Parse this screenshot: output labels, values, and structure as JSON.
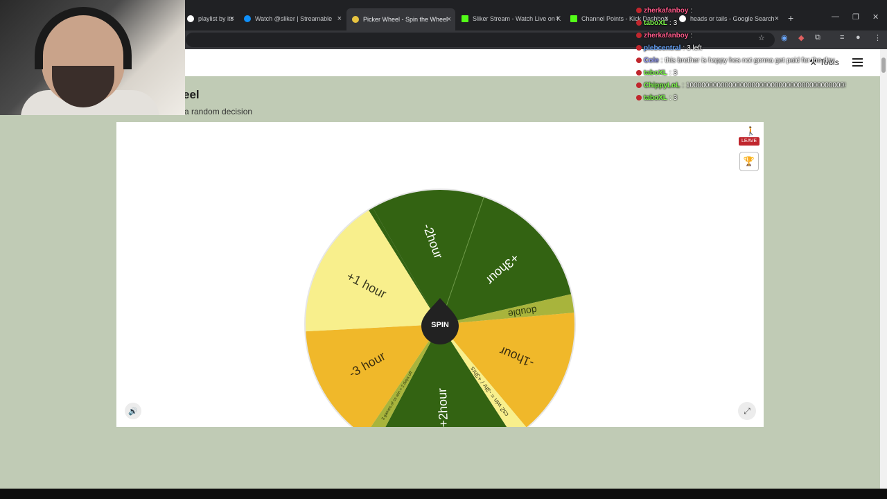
{
  "browser": {
    "tabs": [
      {
        "label": "playlist by its",
        "favicon_color": "#ffffff",
        "active": false
      },
      {
        "label": "Watch @sliker | Streamable",
        "favicon_color": "#0f90fa",
        "active": false
      },
      {
        "label": "Picker Wheel - Spin the Wheel",
        "favicon_color": "#e8c440",
        "active": true
      },
      {
        "label": "Sliker Stream - Watch Live on K",
        "favicon_color": "#53fc18",
        "active": false
      },
      {
        "label": "Channel Points - Kick Dashboa",
        "favicon_color": "#53fc18",
        "active": false
      },
      {
        "label": "heads or tails - Google Search",
        "favicon_color": "#ffffff",
        "active": false
      }
    ],
    "new_tab_label": "+",
    "tab_close_glyph": "×"
  },
  "site": {
    "title": "eel",
    "subtitle": "e a random decision",
    "tools_label": "Tools"
  },
  "wheel": {
    "spin_label": "SPIN",
    "leave_label": "LEAVE",
    "segments": [
      {
        "label": "-2hour",
        "color": "#336312",
        "text_color": "#ffffff"
      },
      {
        "label": "+3hour",
        "color": "#336312",
        "text_color": "#ffffff"
      },
      {
        "label": "double",
        "color": "#a8b43c",
        "text_color": "#2d3a10"
      },
      {
        "label": "-1hour",
        "color": "#f0b82a",
        "text_color": "#3a2e10"
      },
      {
        "label": "cs2 win = -3hr / +3hrs",
        "color": "#f8ef8c",
        "text_color": "#3a3a20"
      },
      {
        "label": "+2hour",
        "color": "#336312",
        "text_color": "#ffffff"
      },
      {
        "label": "3 games of cs win = 2 days off",
        "color": "#a8b43c",
        "text_color": "#2d3a10"
      },
      {
        "label": "-3 hour",
        "color": "#f0b82a",
        "text_color": "#3a2e10"
      },
      {
        "label": "+1 hour",
        "color": "#f8ef8c",
        "text_color": "#3a3a20"
      },
      {
        "label": "-2hour",
        "color": "#336312",
        "text_color": "#ffffff"
      }
    ]
  },
  "chat": [
    {
      "user": "zherkafanboy",
      "message": "",
      "user_color": "#ff5a8a"
    },
    {
      "user": "taboXL",
      "message": "3",
      "user_color": "#7dfa4a"
    },
    {
      "user": "zherkafanboy",
      "message": "",
      "user_color": "#ff5a8a"
    },
    {
      "user": "plebcentral",
      "message": "3 left",
      "user_color": "#6aa8ff"
    },
    {
      "user": "Cole",
      "message": "this brother is happy hes not gonna get paid for the day",
      "user_color": "#9aa0ff"
    },
    {
      "user": "taboXL",
      "message": "3",
      "user_color": "#7dfa4a"
    },
    {
      "user": "ChippyLoL",
      "message": "10000000000000000000000000000000000000000!",
      "user_color": "#7dfa4a"
    },
    {
      "user": "taboXL",
      "message": "3",
      "user_color": "#7dfa4a"
    }
  ],
  "icons": {
    "trophy": "trophy-icon",
    "sound": "speaker-icon",
    "fullscreen": "expand-icon",
    "leave": "walking-person-icon",
    "tools": "tools-icon",
    "menu": "hamburger-icon"
  }
}
